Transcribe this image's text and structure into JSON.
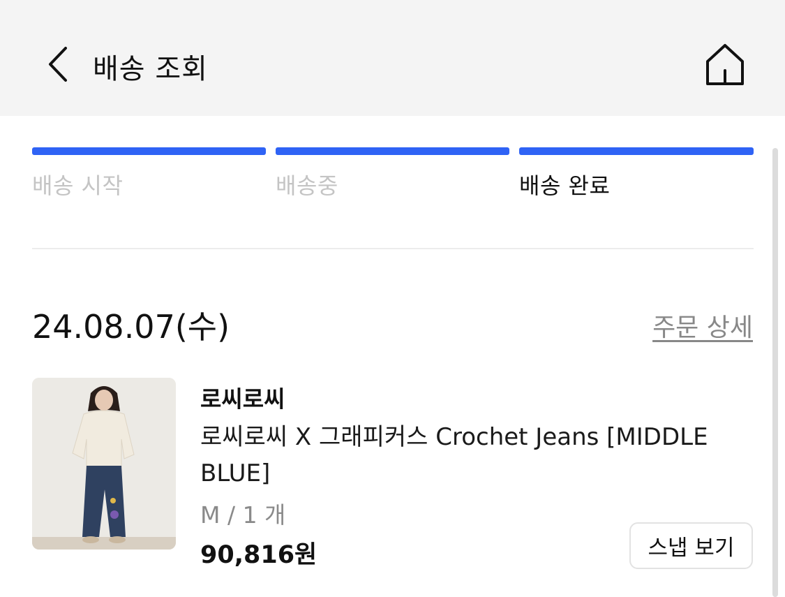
{
  "header": {
    "title": "배송 조회",
    "back_icon": "chevron-left-icon",
    "home_icon": "home-icon",
    "background": "#f4f4f4"
  },
  "progress": {
    "steps": [
      {
        "label": "배송 시작",
        "active": false
      },
      {
        "label": "배송중",
        "active": false
      },
      {
        "label": "배송 완료",
        "active": true
      }
    ],
    "bar_color": "#2f63f5",
    "inactive_label_color": "#c4c4c4",
    "active_label_color": "#111111"
  },
  "order": {
    "date": "24.08.07(수)",
    "detail_link": "주문 상세",
    "item": {
      "brand": "로씨로씨",
      "name": "로씨로씨 X 그래피커스 Crochet Jeans [MIDDLE BLUE]",
      "option": "M / 1 개",
      "price": "90,816원",
      "snap_button": "스냅 보기"
    }
  }
}
